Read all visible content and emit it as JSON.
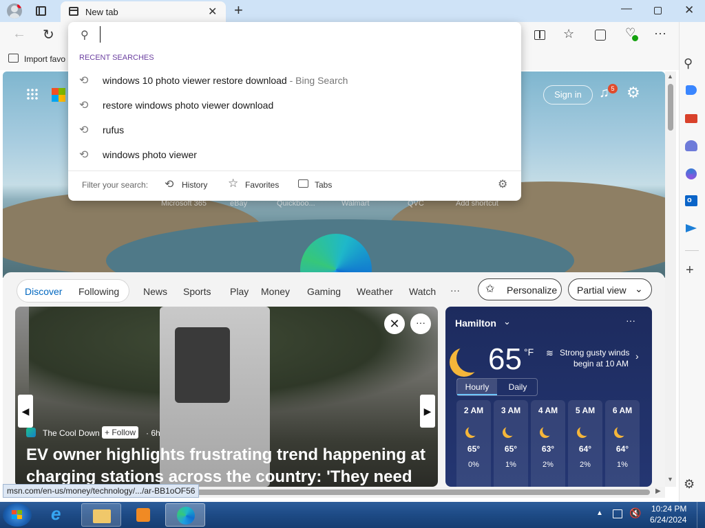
{
  "browser": {
    "tab_title": "New tab",
    "address_value": "",
    "favbar_label": "Import favo"
  },
  "dropdown": {
    "section_title": "RECENT SEARCHES",
    "suggestions": [
      {
        "text": "windows 10 photo viewer restore download",
        "source": "- Bing Search"
      },
      {
        "text": "restore windows photo viewer download",
        "source": ""
      },
      {
        "text": "rufus",
        "source": ""
      },
      {
        "text": "windows photo viewer",
        "source": ""
      }
    ],
    "filter_label": "Filter your search:",
    "filters": [
      "History",
      "Favorites",
      "Tabs"
    ]
  },
  "header": {
    "sign_in": "Sign in",
    "notification_count": "5"
  },
  "quicklinks": [
    "Microsoft 365",
    "eBay",
    "Quickboo...",
    "Walmart",
    "QVC",
    "Add shortcut"
  ],
  "feed_nav": {
    "tabs": [
      "Discover",
      "Following",
      "News",
      "Sports",
      "Play",
      "Money",
      "Gaming",
      "Weather",
      "Watch"
    ],
    "more": "···",
    "personalize": "Personalize",
    "view_select": "Partial view"
  },
  "news": {
    "source": "The Cool Down",
    "follow": "+ Follow",
    "age": "· 6h",
    "headline": "EV owner highlights frustrating trend happening at charging stations across the country: 'They need to..."
  },
  "weather": {
    "location": "Hamilton",
    "temp": "65",
    "unit": "°F",
    "alert_line1": "Strong gusty winds",
    "alert_line2": "begin at 10 AM",
    "tabs": [
      "Hourly",
      "Daily"
    ],
    "hours": [
      {
        "time": "2 AM",
        "temp": "65°",
        "precip": "0%"
      },
      {
        "time": "3 AM",
        "temp": "65°",
        "precip": "1%"
      },
      {
        "time": "4 AM",
        "temp": "63°",
        "precip": "2%"
      },
      {
        "time": "5 AM",
        "temp": "64°",
        "precip": "2%"
      },
      {
        "time": "6 AM",
        "temp": "64°",
        "precip": "1%"
      }
    ]
  },
  "status_url": "msn.com/en-us/money/technology/.../ar-BB1oOF56",
  "taskbar": {
    "time": "10:24 PM",
    "date": "6/24/2024"
  },
  "colors": {
    "accent": "#0067c0",
    "dropdown_section": "#6b3fa0",
    "weather_bg": "#1d2b5e"
  }
}
